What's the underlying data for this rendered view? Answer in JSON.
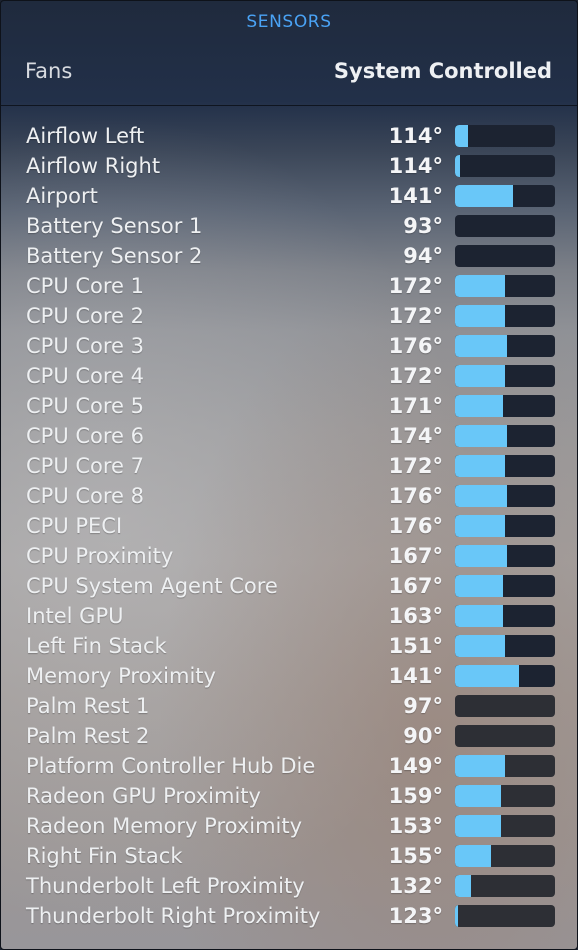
{
  "header": {
    "title": "SENSORS"
  },
  "fans": {
    "label": "Fans",
    "value": "System Controlled"
  },
  "colors": {
    "accent": "#4aa3f5",
    "bar_fill": "#69c7f8",
    "bar_track": "#1c2331"
  },
  "sensors": [
    {
      "name": "Airflow Left",
      "temp": "114°",
      "level": 0.13
    },
    {
      "name": "Airflow Right",
      "temp": "114°",
      "level": 0.05
    },
    {
      "name": "Airport",
      "temp": "141°",
      "level": 0.58
    },
    {
      "name": "Battery Sensor 1",
      "temp": "93°",
      "level": 0.0
    },
    {
      "name": "Battery Sensor 2",
      "temp": "94°",
      "level": 0.0
    },
    {
      "name": "CPU Core 1",
      "temp": "172°",
      "level": 0.5
    },
    {
      "name": "CPU Core 2",
      "temp": "172°",
      "level": 0.5
    },
    {
      "name": "CPU Core 3",
      "temp": "176°",
      "level": 0.52
    },
    {
      "name": "CPU Core 4",
      "temp": "172°",
      "level": 0.5
    },
    {
      "name": "CPU Core 5",
      "temp": "171°",
      "level": 0.48
    },
    {
      "name": "CPU Core 6",
      "temp": "174°",
      "level": 0.52
    },
    {
      "name": "CPU Core 7",
      "temp": "172°",
      "level": 0.5
    },
    {
      "name": "CPU Core 8",
      "temp": "176°",
      "level": 0.52
    },
    {
      "name": "CPU PECI",
      "temp": "176°",
      "level": 0.5
    },
    {
      "name": "CPU Proximity",
      "temp": "167°",
      "level": 0.52
    },
    {
      "name": "CPU System Agent Core",
      "temp": "167°",
      "level": 0.48
    },
    {
      "name": "Intel GPU",
      "temp": "163°",
      "level": 0.48
    },
    {
      "name": "Left Fin Stack",
      "temp": "151°",
      "level": 0.5
    },
    {
      "name": "Memory Proximity",
      "temp": "141°",
      "level": 0.64
    },
    {
      "name": "Palm Rest 1",
      "temp": "97°",
      "level": 0.0
    },
    {
      "name": "Palm Rest 2",
      "temp": "90°",
      "level": 0.0
    },
    {
      "name": "Platform Controller Hub Die",
      "temp": "149°",
      "level": 0.5
    },
    {
      "name": "Radeon GPU Proximity",
      "temp": "159°",
      "level": 0.46
    },
    {
      "name": "Radeon Memory Proximity",
      "temp": "153°",
      "level": 0.46
    },
    {
      "name": "Right Fin Stack",
      "temp": "155°",
      "level": 0.36
    },
    {
      "name": "Thunderbolt Left Proximity",
      "temp": "132°",
      "level": 0.16
    },
    {
      "name": "Thunderbolt Right Proximity",
      "temp": "123°",
      "level": 0.03
    }
  ]
}
